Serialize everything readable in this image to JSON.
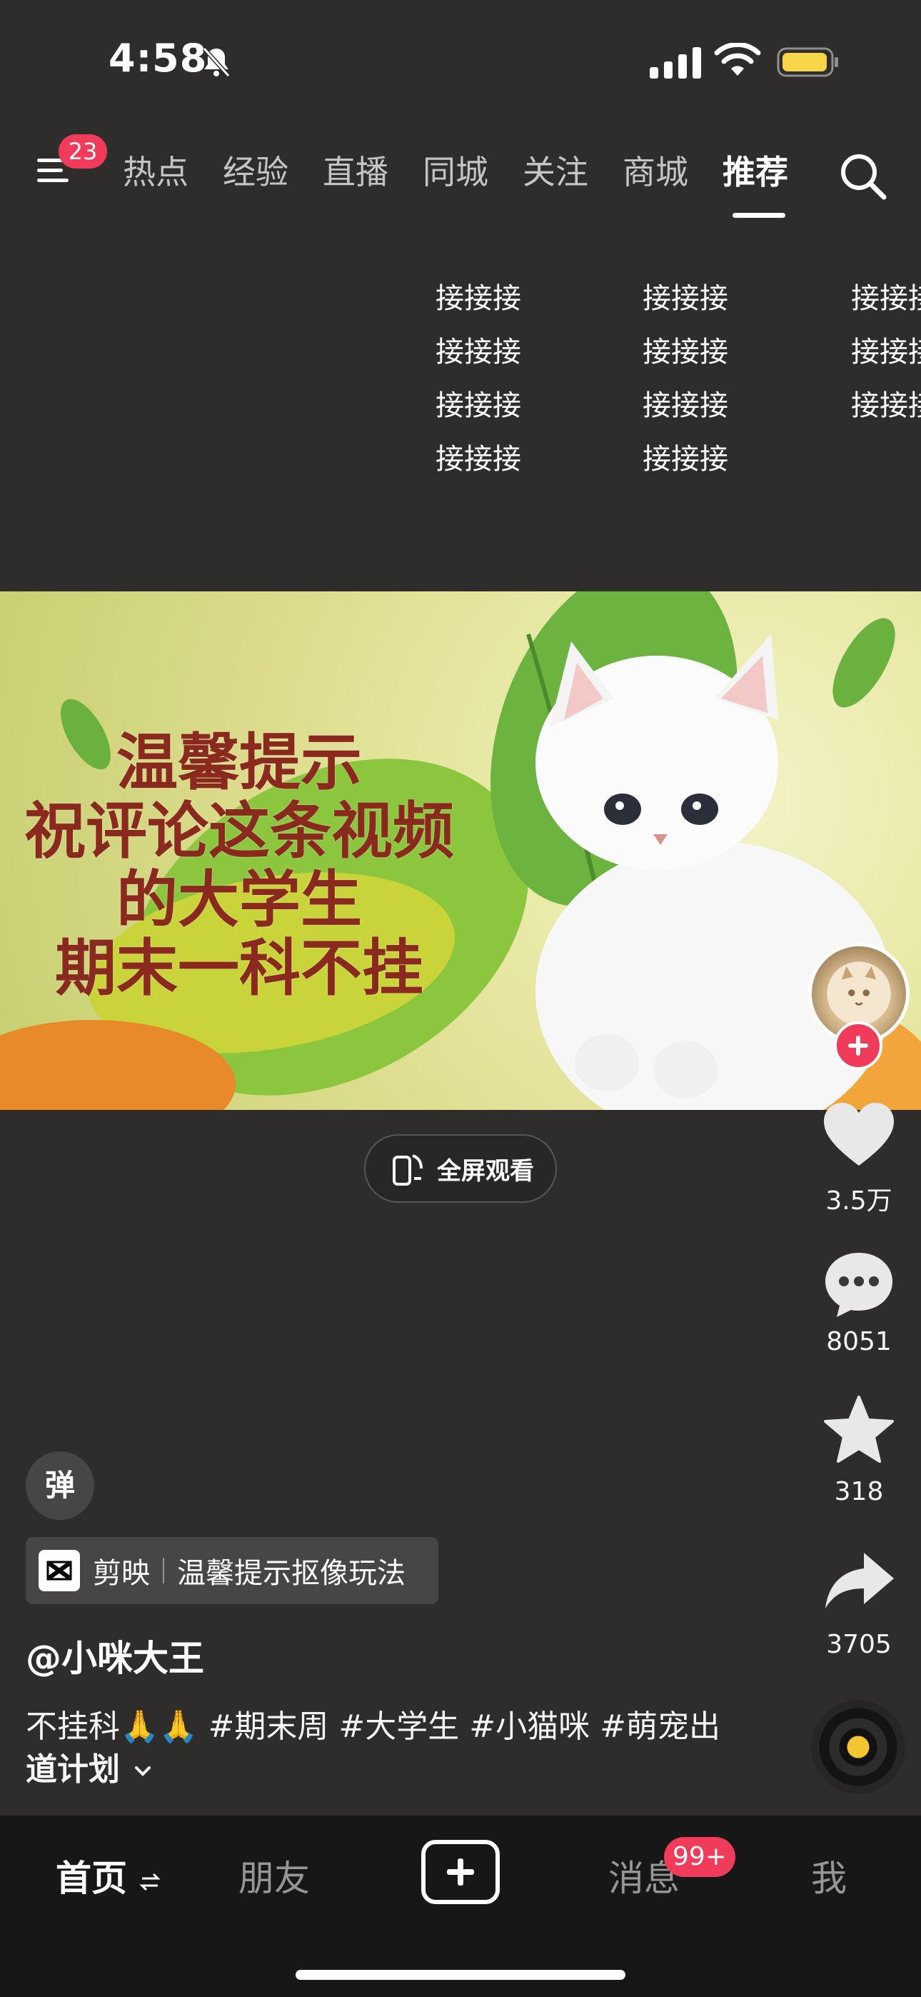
{
  "status_bar": {
    "time": "4:58"
  },
  "top_nav": {
    "menu_badge": "23",
    "tabs": [
      "热点",
      "经验",
      "直播",
      "同城",
      "关注",
      "商城",
      "推荐"
    ],
    "active_tab": "推荐"
  },
  "overlay_text": {
    "word": "接接接"
  },
  "video": {
    "caption_lines": [
      "温馨提示",
      "祝评论这条视频",
      "的大学生",
      "期末一科不挂"
    ],
    "fullscreen_label": "全屏观看"
  },
  "rail": {
    "likes": "3.5万",
    "comments": "8051",
    "favorites": "318",
    "shares": "3705"
  },
  "bottom_info": {
    "danmu_label": "弹",
    "capcut_app": "剪映",
    "capcut_effect": "温馨提示抠像玩法",
    "author": "@小咪大王",
    "description": "不挂科🙏🙏 #期末周 #大学生 #小猫咪 #萌宠出",
    "description_line2": "道计划"
  },
  "bottom_nav": {
    "home": "首页",
    "friends": "朋友",
    "messages": "消息",
    "messages_badge": "99+",
    "me": "我"
  },
  "colors": {
    "background": "#2e2d2b",
    "badge": "#f03b5a",
    "caption": "#8a2a1e"
  }
}
